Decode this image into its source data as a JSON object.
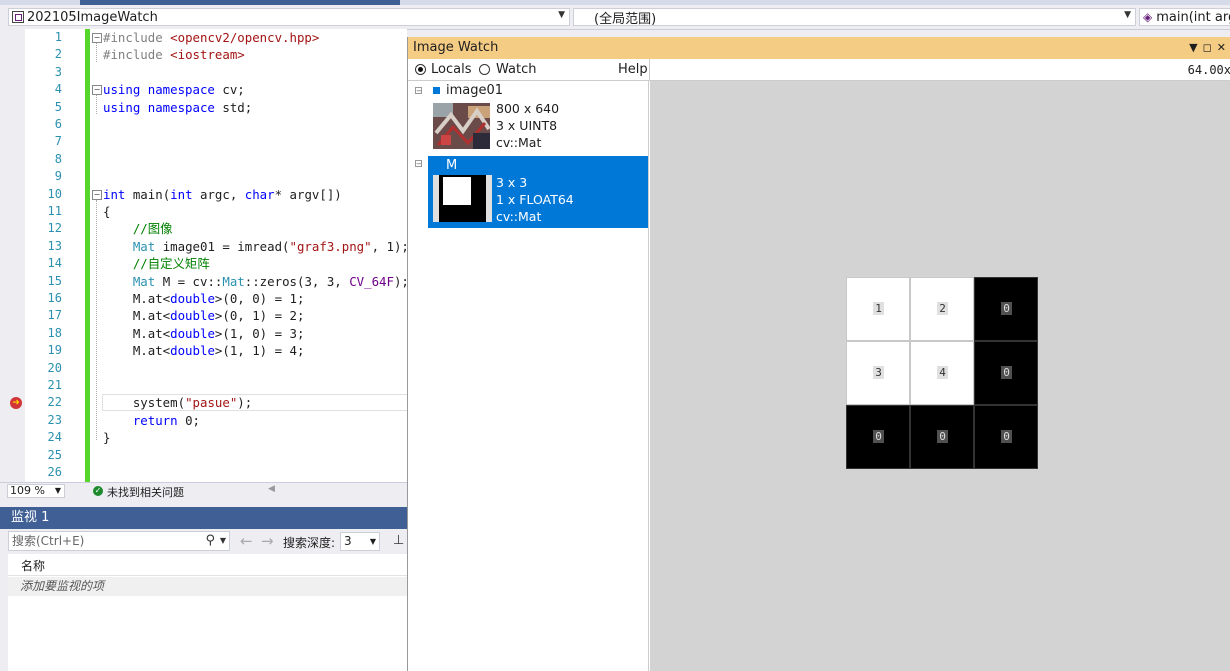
{
  "navbar": {
    "project": "202105ImageWatch",
    "scope": "(全局范围)",
    "function": "main(int argc"
  },
  "editor": {
    "line_numbers": [
      "1",
      "2",
      "3",
      "4",
      "5",
      "6",
      "7",
      "8",
      "9",
      "10",
      "11",
      "12",
      "13",
      "14",
      "15",
      "16",
      "17",
      "18",
      "19",
      "20",
      "21",
      "22",
      "23",
      "24",
      "25",
      "26"
    ],
    "current_line": "22",
    "zoom": "109 %",
    "issues_text": "未找到相关问题"
  },
  "watch": {
    "title": "监视 1",
    "search_placeholder": "搜索(Ctrl+E)",
    "depth_label": "搜索深度:",
    "depth_value": "3",
    "column_name": "名称",
    "add_item": "添加要监视的项"
  },
  "imagewatch": {
    "title": "Image Watch",
    "locals_label": "Locals",
    "watch_label": "Watch",
    "help_label": "Help",
    "zoom_readout": "64.00x",
    "items": [
      {
        "name": "image01",
        "size": "800 x 640",
        "channels": "3 x UINT8",
        "type": "cv::Mat"
      },
      {
        "name": "M",
        "size": "3 x 3",
        "channels": "1 x FLOAT64",
        "type": "cv::Mat"
      }
    ],
    "matrix": [
      [
        "1",
        "2",
        "0"
      ],
      [
        "3",
        "4",
        "0"
      ],
      [
        "0",
        "0",
        "0"
      ]
    ],
    "colors": {
      "title_bg": "#f5cc84",
      "selection": "#0078d7",
      "viewer_bg": "#d3d3d3"
    }
  }
}
